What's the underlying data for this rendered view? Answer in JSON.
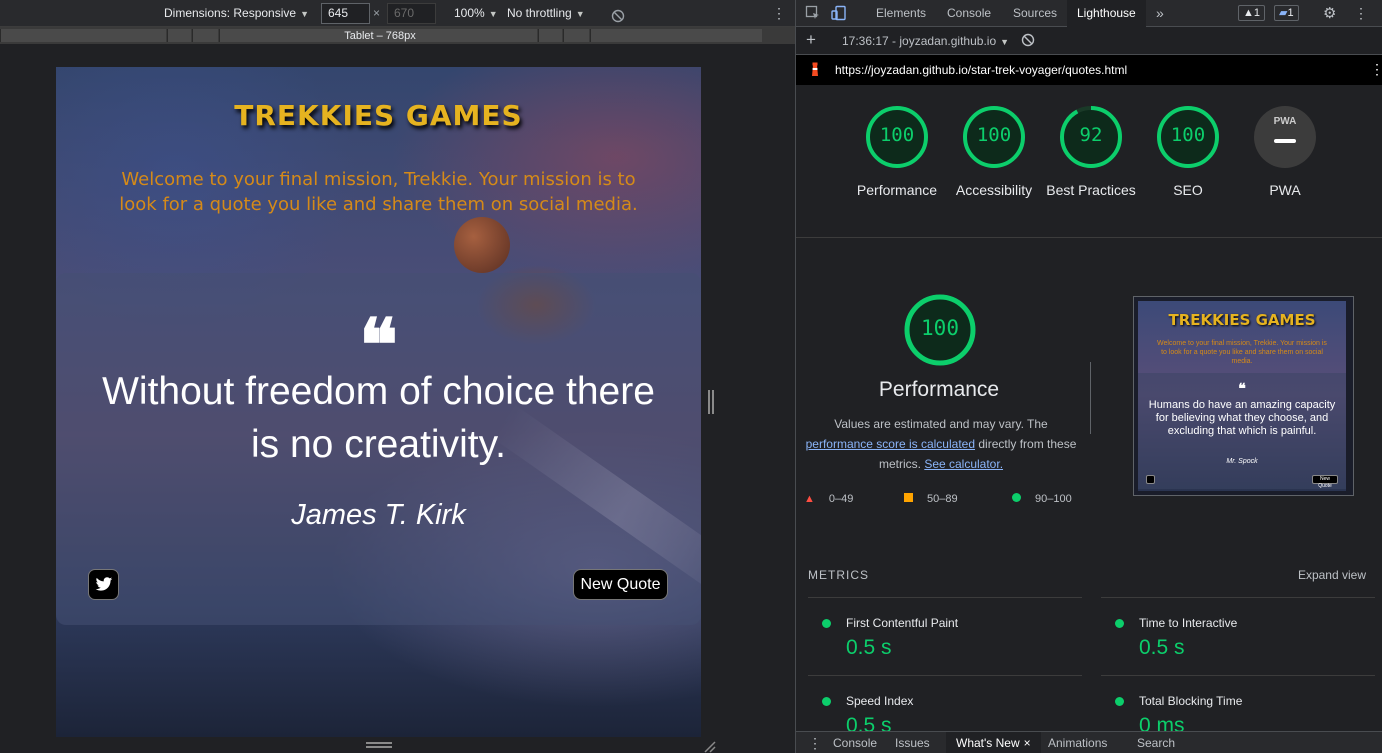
{
  "device_toolbar": {
    "dimensions_label": "Dimensions: Responsive",
    "width": "645",
    "height": "670",
    "times": "×",
    "zoom": "100%",
    "throttling": "No throttling",
    "media_label": "Tablet – 768px"
  },
  "site": {
    "title": "TREKKIES GAMES",
    "welcome": "Welcome to your final mission, Trekkie. Your mission is to look for a quote you like and share them on social media.",
    "quote": "Without freedom of choice there is no creativity.",
    "author": "James T. Kirk",
    "new_quote_label": "New Quote"
  },
  "devtools": {
    "tabs": [
      "Elements",
      "Console",
      "Sources",
      "Lighthouse"
    ],
    "active_tab": "Lighthouse",
    "warnings_count": "1",
    "messages_count": "1",
    "report_time": "17:36:17 - joyzadan.github.io",
    "url": "https://joyzadan.github.io/star-trek-voyager/quotes.html",
    "scores": [
      {
        "label": "Performance",
        "value": "100",
        "fraction": 1.0
      },
      {
        "label": "Accessibility",
        "value": "100",
        "fraction": 1.0
      },
      {
        "label": "Best Practices",
        "value": "92",
        "fraction": 0.92
      },
      {
        "label": "SEO",
        "value": "100",
        "fraction": 1.0
      },
      {
        "label": "PWA",
        "value": "PWA",
        "fraction": 0
      }
    ],
    "performance": {
      "score": "100",
      "title": "Performance",
      "note_prefix": "Values are estimated and may vary. The",
      "note_link": "performance score is calculated",
      "note_middle": "directly from these metrics.",
      "note_calc": "See calculator."
    },
    "legend": {
      "red": "0–49",
      "orange": "50–89",
      "green": "90–100"
    },
    "thumbnail": {
      "title": "TREKKIES GAMES",
      "welcome": "Welcome to your final mission, Trekkie. Your mission is to look for a quote you like and share them on social media.",
      "quote": "Humans do have an amazing capacity for believing what they choose, and excluding that which is painful.",
      "author": "Mr. Spock",
      "new_quote_label": "New Quote"
    },
    "metrics_heading": "METRICS",
    "expand_view": "Expand view",
    "metrics": [
      {
        "name": "First Contentful Paint",
        "value": "0.5 s"
      },
      {
        "name": "Time to Interactive",
        "value": "0.5 s"
      },
      {
        "name": "Speed Index",
        "value": "0.5 s"
      },
      {
        "name": "Total Blocking Time",
        "value": "0 ms"
      }
    ],
    "drawer_tabs": [
      "Console",
      "Issues",
      "What's New",
      "Animations",
      "Search"
    ],
    "close_symbol": "×"
  },
  "colors": {
    "pass": "#0cce6b",
    "average": "#ffa400",
    "fail": "#ff4e42",
    "brand": "#e6b320"
  }
}
